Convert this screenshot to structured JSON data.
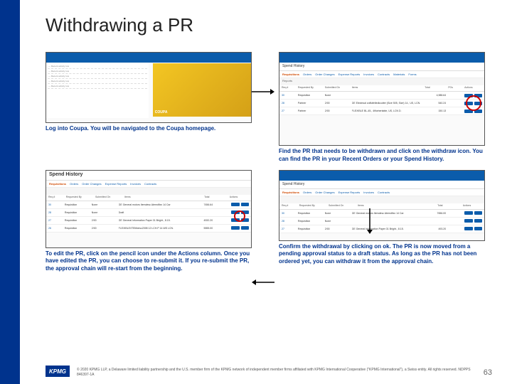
{
  "title": "Withdrawing a PR",
  "captions": {
    "c1": "Log into Coupa. You will be navigated to the Coupa homepage.",
    "c2": "Find the PR that needs to be withdrawn and click on the withdraw icon. You can find the PR in your Recent Orders or your Spend History.",
    "c3": "To edit the PR, click on the pencil icon under the Actions column. Once you have edited the PR, you can choose to re-submit it. If you re-submit the PR, the approval chain will re-start from the beginning.",
    "c4": "Confirm the withdrawal by clicking on ok. The PR is now moved from a pending approval status to a draft status. As long as the PR has not been ordered yet, you can withdraw it from the approval chain."
  },
  "spend_history": {
    "heading": "Spend History",
    "tabs": [
      "Requisitions",
      "Orders",
      "Order Changes",
      "Expense Reports",
      "Invoices",
      "Contracts",
      "Materials",
      "Forms"
    ],
    "filter_label": "Reports",
    "thead": [
      "Req #",
      "Requested By",
      "Submitted On",
      "Items",
      "Total",
      "POs",
      "Actions"
    ],
    "rows": [
      {
        "req": "30",
        "by": "Requisition",
        "sub": "None",
        "items": "",
        "total": "4,988.64",
        "po": "",
        "act": true
      },
      {
        "req": "28",
        "by": "Partner",
        "sub": "2/00",
        "items": "GE Electrical zolfiafelledkcutter (Size 505, Size) 14., US, LCN.",
        "total": "540.24",
        "po": "",
        "act": true
      },
      {
        "req": "27",
        "by": "Partner",
        "sub": "2/00",
        "items": "FLEXIBLE BL-45., 4f/twhertable, US, LCN D.",
        "total": "150.13",
        "po": "",
        "act": true
      }
    ],
    "rows3": [
      {
        "req": "30",
        "by": "Requisition",
        "sub": "None",
        "items": "GE General motors Itemdesc Atemdfixx 14 Car",
        "total": "7456.64",
        "po": "",
        "act": true
      },
      {
        "req": "28",
        "by": "Requisition",
        "sub": "None",
        "items": "Draft",
        "total": "",
        "po": "",
        "act": true
      },
      {
        "req": "27",
        "by": "Requisition",
        "sub": "2/00",
        "items": "GE General Information Paper 31 Bright., 8.15.",
        "total": "4532.20",
        "po": "",
        "act": true
      },
      {
        "req": "26",
        "by": "Requisition",
        "sub": "2/00",
        "items": "FLEXIBLE/ITEMdesc2398 12 LCH.P 14.WS LCN.",
        "total": "5555.00",
        "po": "",
        "act": true
      }
    ],
    "rows4": [
      {
        "req": "30",
        "by": "Requisition",
        "sub": "None",
        "items": "GE General motors Itemdesc Atemdfixx 14 Car",
        "total": "7656.00",
        "po": "",
        "act": true
      },
      {
        "req": "28",
        "by": "Requisition",
        "sub": "None",
        "items": "",
        "total": "",
        "po": "",
        "act": true
      },
      {
        "req": "27",
        "by": "Requisition",
        "sub": "2/00",
        "items": "GE General Information Paper 31 Bright., 8.15.",
        "total": "493.20",
        "po": "",
        "act": true
      }
    ]
  },
  "home": {
    "banner": "COUPA",
    "lines": [
      "— Recent activity row",
      "— Recent activity row",
      "— Recent activity row",
      "— Recent activity row",
      "— Recent activity row"
    ]
  },
  "footer": {
    "logo": "KPMG",
    "copyright": "© 2020 KPMG LLP, a Delaware limited liability partnership and the U.S. member firm of the KPMG network of independent member firms affiliated with KPMG International Cooperative (\"KPMG International\"), a Swiss entity. All rights reserved. NDPPS 846397-1A",
    "page": "63"
  }
}
